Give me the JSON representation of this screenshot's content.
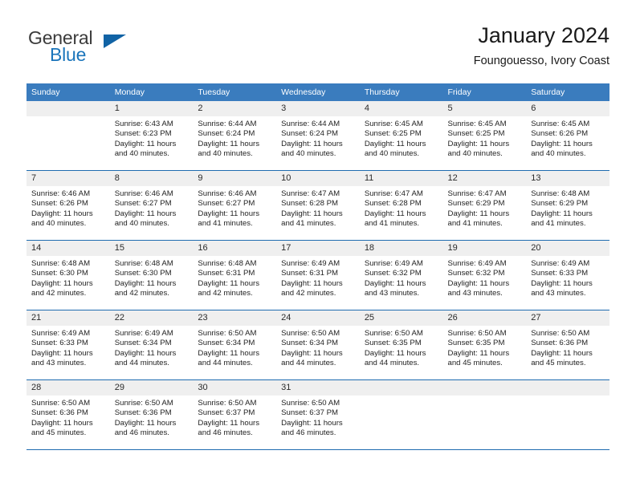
{
  "brand": {
    "name_part1": "General",
    "name_part2": "Blue",
    "triangle_color": "#1163a5"
  },
  "header": {
    "title": "January 2024",
    "subtitle": "Foungouesso, Ivory Coast"
  },
  "theme": {
    "header_row_bg": "#3a7cbe",
    "row_divider": "#1f6cb0",
    "daynum_bg": "#efefef",
    "brand_blue": "#1b75bb"
  },
  "calendar": {
    "weekday_headers": [
      "Sunday",
      "Monday",
      "Tuesday",
      "Wednesday",
      "Thursday",
      "Friday",
      "Saturday"
    ],
    "labels": {
      "sunrise_prefix": "Sunrise:",
      "sunset_prefix": "Sunset:",
      "daylight_prefix": "Daylight:"
    },
    "weeks": [
      [
        {
          "day": "",
          "empty": true,
          "sunrise": "",
          "sunset": "",
          "daylight": ""
        },
        {
          "day": "1",
          "sunrise": "Sunrise: 6:43 AM",
          "sunset": "Sunset: 6:23 PM",
          "daylight": "Daylight: 11 hours and 40 minutes."
        },
        {
          "day": "2",
          "sunrise": "Sunrise: 6:44 AM",
          "sunset": "Sunset: 6:24 PM",
          "daylight": "Daylight: 11 hours and 40 minutes."
        },
        {
          "day": "3",
          "sunrise": "Sunrise: 6:44 AM",
          "sunset": "Sunset: 6:24 PM",
          "daylight": "Daylight: 11 hours and 40 minutes."
        },
        {
          "day": "4",
          "sunrise": "Sunrise: 6:45 AM",
          "sunset": "Sunset: 6:25 PM",
          "daylight": "Daylight: 11 hours and 40 minutes."
        },
        {
          "day": "5",
          "sunrise": "Sunrise: 6:45 AM",
          "sunset": "Sunset: 6:25 PM",
          "daylight": "Daylight: 11 hours and 40 minutes."
        },
        {
          "day": "6",
          "sunrise": "Sunrise: 6:45 AM",
          "sunset": "Sunset: 6:26 PM",
          "daylight": "Daylight: 11 hours and 40 minutes."
        }
      ],
      [
        {
          "day": "7",
          "sunrise": "Sunrise: 6:46 AM",
          "sunset": "Sunset: 6:26 PM",
          "daylight": "Daylight: 11 hours and 40 minutes."
        },
        {
          "day": "8",
          "sunrise": "Sunrise: 6:46 AM",
          "sunset": "Sunset: 6:27 PM",
          "daylight": "Daylight: 11 hours and 40 minutes."
        },
        {
          "day": "9",
          "sunrise": "Sunrise: 6:46 AM",
          "sunset": "Sunset: 6:27 PM",
          "daylight": "Daylight: 11 hours and 41 minutes."
        },
        {
          "day": "10",
          "sunrise": "Sunrise: 6:47 AM",
          "sunset": "Sunset: 6:28 PM",
          "daylight": "Daylight: 11 hours and 41 minutes."
        },
        {
          "day": "11",
          "sunrise": "Sunrise: 6:47 AM",
          "sunset": "Sunset: 6:28 PM",
          "daylight": "Daylight: 11 hours and 41 minutes."
        },
        {
          "day": "12",
          "sunrise": "Sunrise: 6:47 AM",
          "sunset": "Sunset: 6:29 PM",
          "daylight": "Daylight: 11 hours and 41 minutes."
        },
        {
          "day": "13",
          "sunrise": "Sunrise: 6:48 AM",
          "sunset": "Sunset: 6:29 PM",
          "daylight": "Daylight: 11 hours and 41 minutes."
        }
      ],
      [
        {
          "day": "14",
          "sunrise": "Sunrise: 6:48 AM",
          "sunset": "Sunset: 6:30 PM",
          "daylight": "Daylight: 11 hours and 42 minutes."
        },
        {
          "day": "15",
          "sunrise": "Sunrise: 6:48 AM",
          "sunset": "Sunset: 6:30 PM",
          "daylight": "Daylight: 11 hours and 42 minutes."
        },
        {
          "day": "16",
          "sunrise": "Sunrise: 6:48 AM",
          "sunset": "Sunset: 6:31 PM",
          "daylight": "Daylight: 11 hours and 42 minutes."
        },
        {
          "day": "17",
          "sunrise": "Sunrise: 6:49 AM",
          "sunset": "Sunset: 6:31 PM",
          "daylight": "Daylight: 11 hours and 42 minutes."
        },
        {
          "day": "18",
          "sunrise": "Sunrise: 6:49 AM",
          "sunset": "Sunset: 6:32 PM",
          "daylight": "Daylight: 11 hours and 43 minutes."
        },
        {
          "day": "19",
          "sunrise": "Sunrise: 6:49 AM",
          "sunset": "Sunset: 6:32 PM",
          "daylight": "Daylight: 11 hours and 43 minutes."
        },
        {
          "day": "20",
          "sunrise": "Sunrise: 6:49 AM",
          "sunset": "Sunset: 6:33 PM",
          "daylight": "Daylight: 11 hours and 43 minutes."
        }
      ],
      [
        {
          "day": "21",
          "sunrise": "Sunrise: 6:49 AM",
          "sunset": "Sunset: 6:33 PM",
          "daylight": "Daylight: 11 hours and 43 minutes."
        },
        {
          "day": "22",
          "sunrise": "Sunrise: 6:49 AM",
          "sunset": "Sunset: 6:34 PM",
          "daylight": "Daylight: 11 hours and 44 minutes."
        },
        {
          "day": "23",
          "sunrise": "Sunrise: 6:50 AM",
          "sunset": "Sunset: 6:34 PM",
          "daylight": "Daylight: 11 hours and 44 minutes."
        },
        {
          "day": "24",
          "sunrise": "Sunrise: 6:50 AM",
          "sunset": "Sunset: 6:34 PM",
          "daylight": "Daylight: 11 hours and 44 minutes."
        },
        {
          "day": "25",
          "sunrise": "Sunrise: 6:50 AM",
          "sunset": "Sunset: 6:35 PM",
          "daylight": "Daylight: 11 hours and 44 minutes."
        },
        {
          "day": "26",
          "sunrise": "Sunrise: 6:50 AM",
          "sunset": "Sunset: 6:35 PM",
          "daylight": "Daylight: 11 hours and 45 minutes."
        },
        {
          "day": "27",
          "sunrise": "Sunrise: 6:50 AM",
          "sunset": "Sunset: 6:36 PM",
          "daylight": "Daylight: 11 hours and 45 minutes."
        }
      ],
      [
        {
          "day": "28",
          "sunrise": "Sunrise: 6:50 AM",
          "sunset": "Sunset: 6:36 PM",
          "daylight": "Daylight: 11 hours and 45 minutes."
        },
        {
          "day": "29",
          "sunrise": "Sunrise: 6:50 AM",
          "sunset": "Sunset: 6:36 PM",
          "daylight": "Daylight: 11 hours and 46 minutes."
        },
        {
          "day": "30",
          "sunrise": "Sunrise: 6:50 AM",
          "sunset": "Sunset: 6:37 PM",
          "daylight": "Daylight: 11 hours and 46 minutes."
        },
        {
          "day": "31",
          "sunrise": "Sunrise: 6:50 AM",
          "sunset": "Sunset: 6:37 PM",
          "daylight": "Daylight: 11 hours and 46 minutes."
        },
        {
          "day": "",
          "empty": true,
          "sunrise": "",
          "sunset": "",
          "daylight": ""
        },
        {
          "day": "",
          "empty": true,
          "sunrise": "",
          "sunset": "",
          "daylight": ""
        },
        {
          "day": "",
          "empty": true,
          "sunrise": "",
          "sunset": "",
          "daylight": ""
        }
      ]
    ]
  }
}
